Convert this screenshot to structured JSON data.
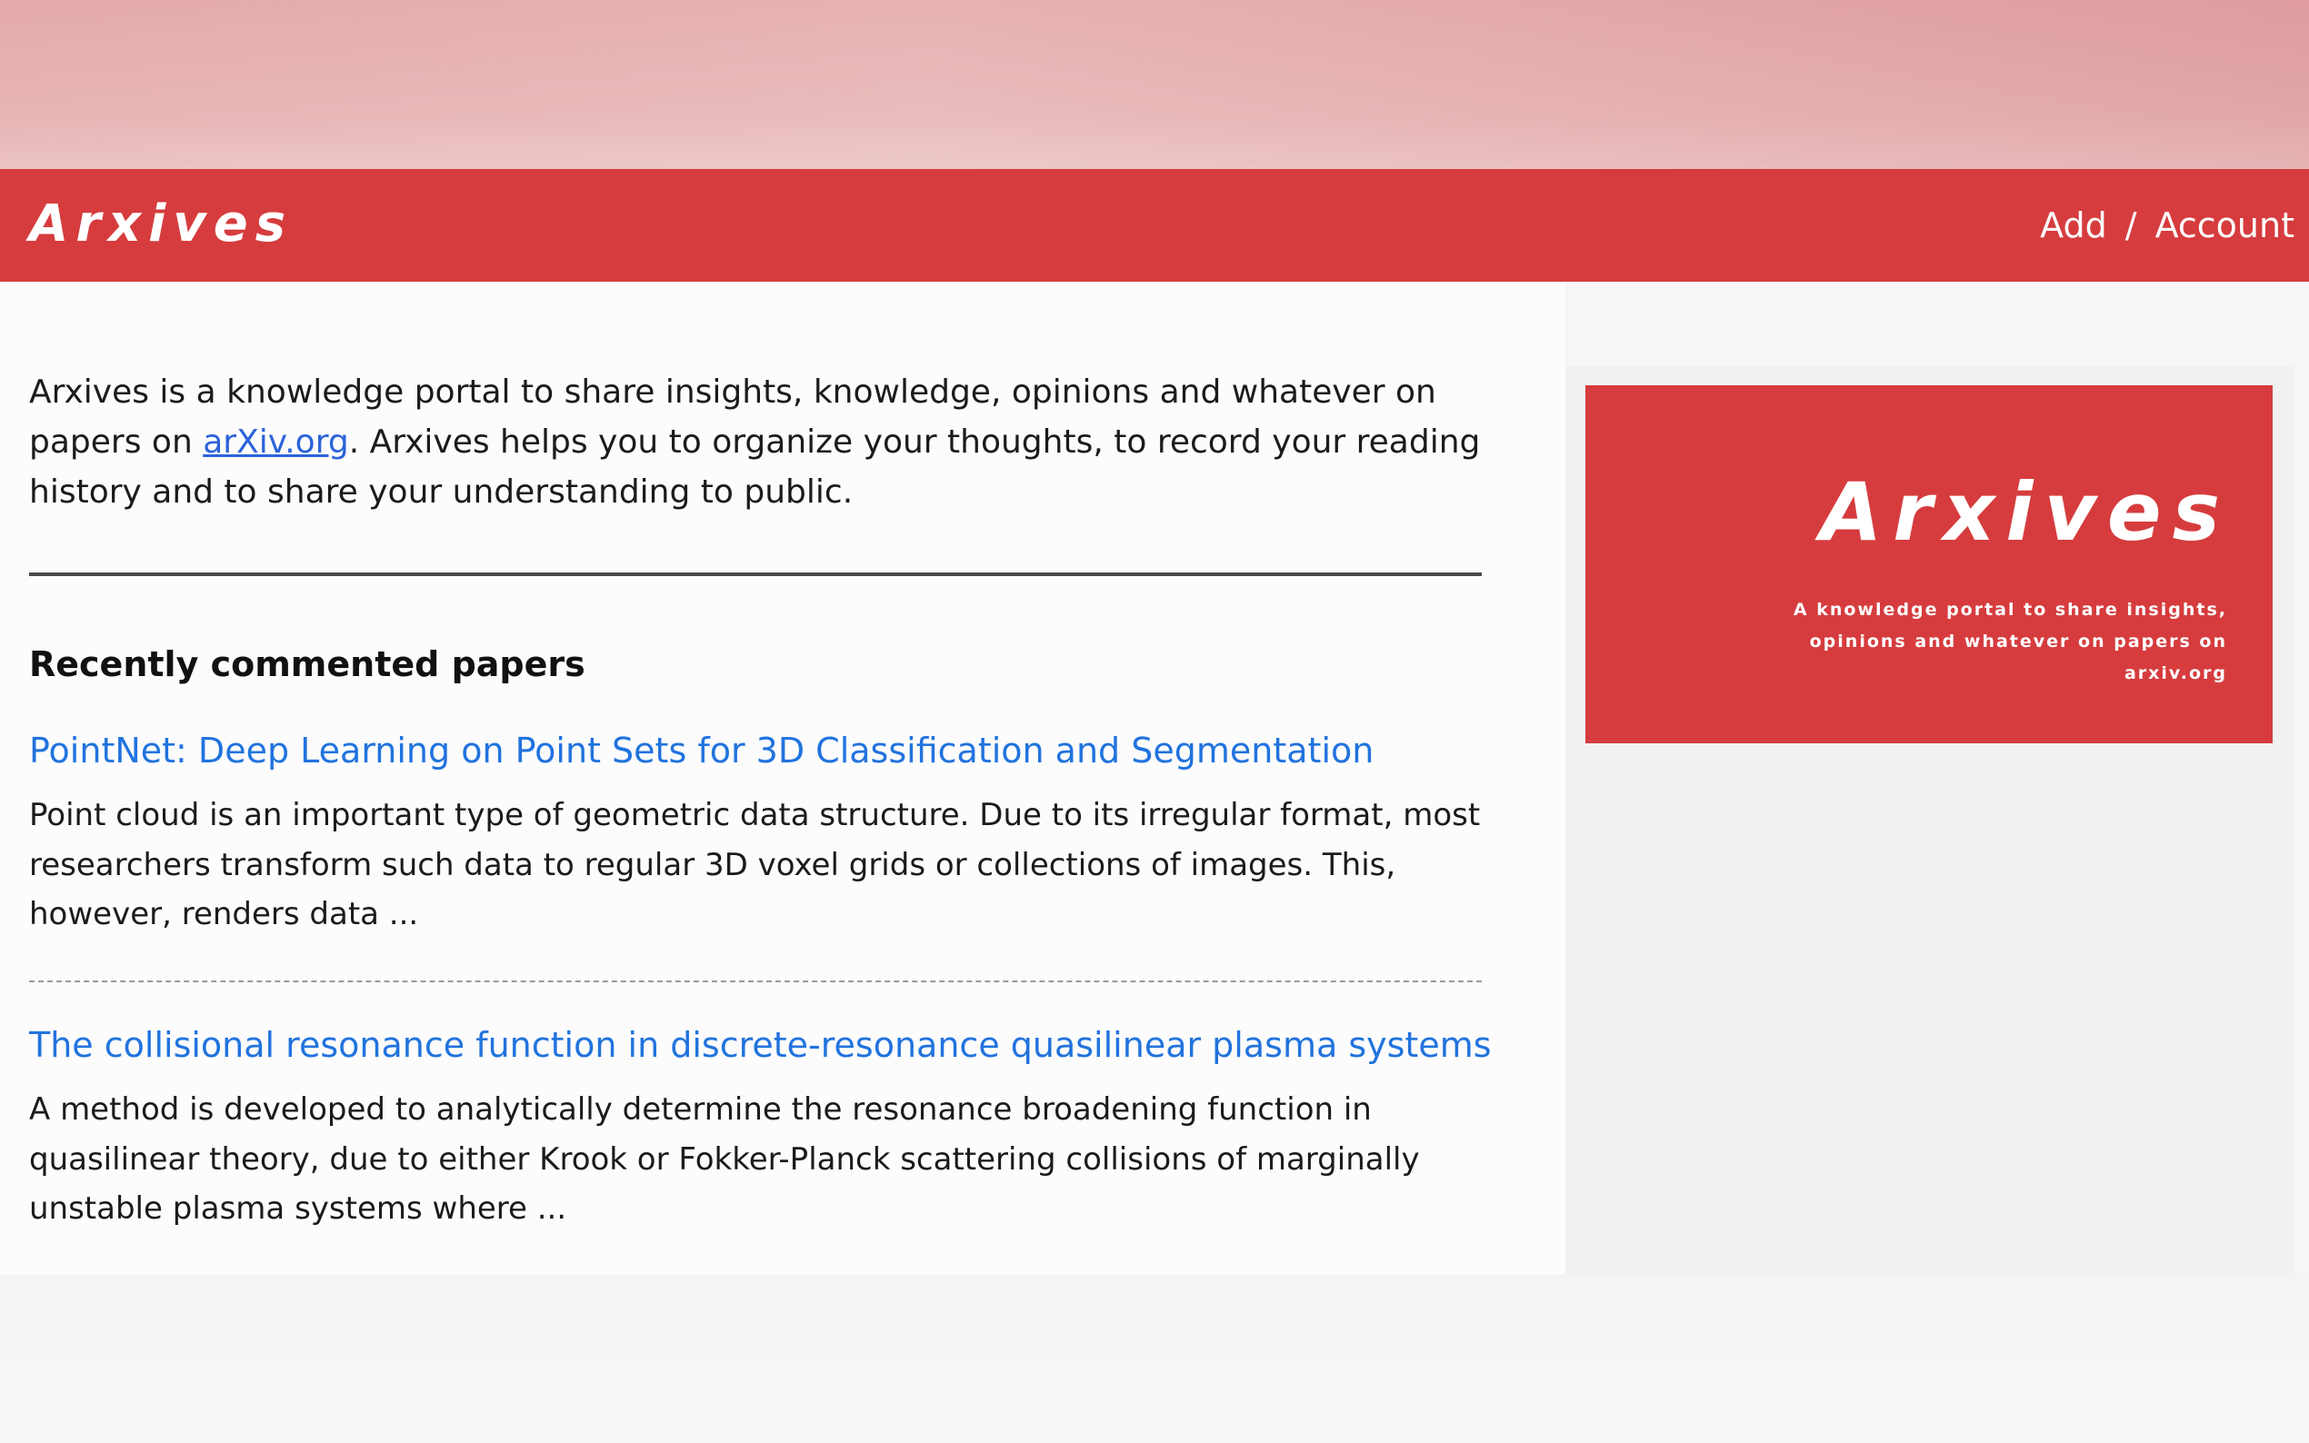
{
  "header": {
    "brand": "Arxives",
    "nav": {
      "add_label": "Add",
      "separator": "/",
      "account_label": "Account"
    }
  },
  "intro": {
    "text_before_link": "Arxives is a knowledge portal to share insights, knowledge, opinions and whatever on papers on ",
    "link_text": "arXiv.org",
    "text_after_link": ". Arxives helps you to organize your thoughts, to record your reading history and to share your understanding to public."
  },
  "recent": {
    "title": "Recently commented papers",
    "papers": [
      {
        "title": "PointNet: Deep Learning on Point Sets for 3D Classification and Segmentation",
        "abstract": "Point cloud is an important type of geometric data structure. Due to its irregular format, most researchers transform such data to regular 3D voxel grids or collections of images. This, however, renders data ..."
      },
      {
        "title": "The collisional resonance function in discrete-resonance quasilinear plasma systems",
        "abstract": "A method is developed to analytically determine the resonance broadening function in quasilinear theory, due to either Krook or Fokker-Planck scattering collisions of marginally unstable plasma systems where ..."
      }
    ]
  },
  "sidebar": {
    "promo": {
      "title": "Arxives",
      "tagline_line1": "A knowledge portal to share insights,",
      "tagline_line2": "opinions and whatever on papers on arxiv.org"
    }
  },
  "colors": {
    "brand_red": "#d63c3e",
    "link_blue": "#2173de",
    "banner_pink": "#e2a4a6"
  }
}
